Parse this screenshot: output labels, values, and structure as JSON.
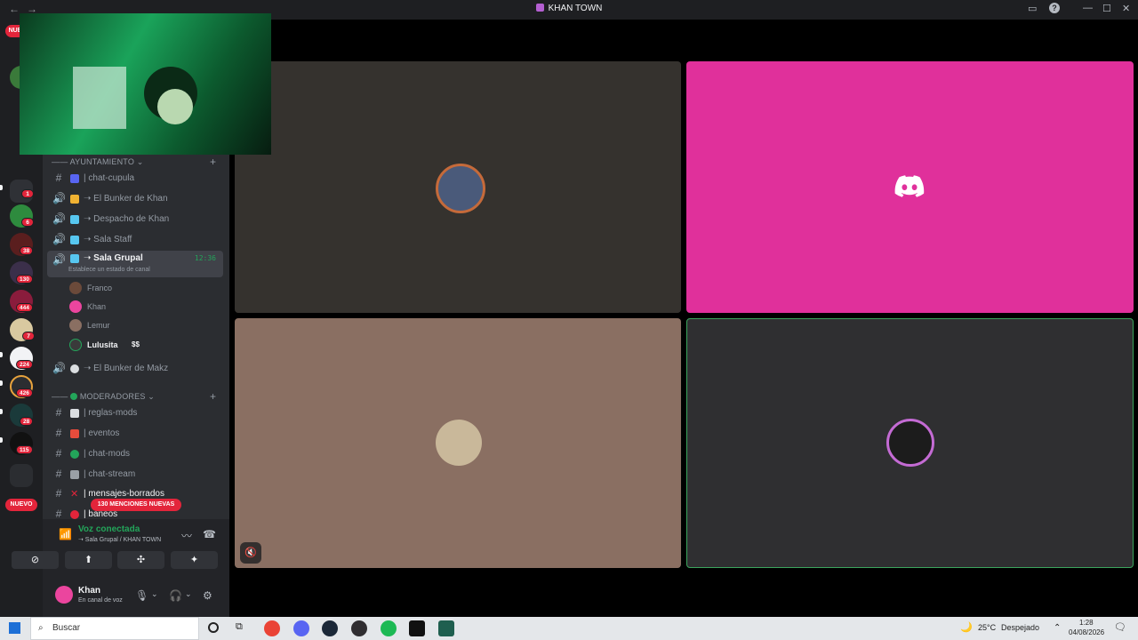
{
  "window": {
    "title": "KHAN TOWN",
    "back_icon": "arrow-left-icon",
    "forward_icon": "arrow-right-icon"
  },
  "rail": {
    "new_badge": "NUE",
    "new_pill": "NUEVO",
    "badges": [
      "1",
      "6",
      "38",
      "130",
      "444",
      "7",
      "224",
      "426",
      "28",
      "115"
    ]
  },
  "sidebar": {
    "categories": [
      {
        "label": "AYUNTAMIENTO"
      },
      {
        "label": "MODERADORES"
      }
    ],
    "channels": [
      {
        "label": "| chat-cupula",
        "type": "text"
      },
      {
        "label": "➝ El Bunker de Khan",
        "type": "voice"
      },
      {
        "label": "➝ Despacho de Khan",
        "type": "voice"
      },
      {
        "label": "➝ Sala Staff",
        "type": "voice"
      },
      {
        "label": "➝ Sala Grupal",
        "type": "voice",
        "time": "12:36",
        "status": "Establece un estado de canal"
      },
      {
        "label": "➝ El Bunker de Makz",
        "type": "voice"
      },
      {
        "label": "| reglas-mods",
        "type": "text"
      },
      {
        "label": "| eventos",
        "type": "text"
      },
      {
        "label": "| chat-mods",
        "type": "text"
      },
      {
        "label": "| chat-stream",
        "type": "text"
      },
      {
        "label": "| mensajes-borrados",
        "type": "text"
      },
      {
        "label": "| baneos",
        "type": "text"
      }
    ],
    "members": [
      {
        "name": "Franco"
      },
      {
        "name": "Khan"
      },
      {
        "name": "Lemur"
      },
      {
        "name": "Lulusita",
        "tag": "$$"
      }
    ],
    "mentions_pill": "130 MENCIONES NUEVAS"
  },
  "voice_panel": {
    "status": "Voz conectada",
    "location": "➝ Sala Grupal / KHAN TOWN"
  },
  "user_panel": {
    "name": "Khan",
    "status": "En canal de voz"
  },
  "taskbar": {
    "search_placeholder": "Buscar",
    "weather_temp": "25°C",
    "weather_desc": "Despejado",
    "time": "1:28",
    "date": "04/08/2026"
  },
  "colors": {
    "accent_pink": "#e0309b",
    "tile_dark": "#35322e",
    "tile_tan": "#8a6f62",
    "tile_gray": "#2f2f31",
    "speaking_border": "#3ba55d"
  }
}
